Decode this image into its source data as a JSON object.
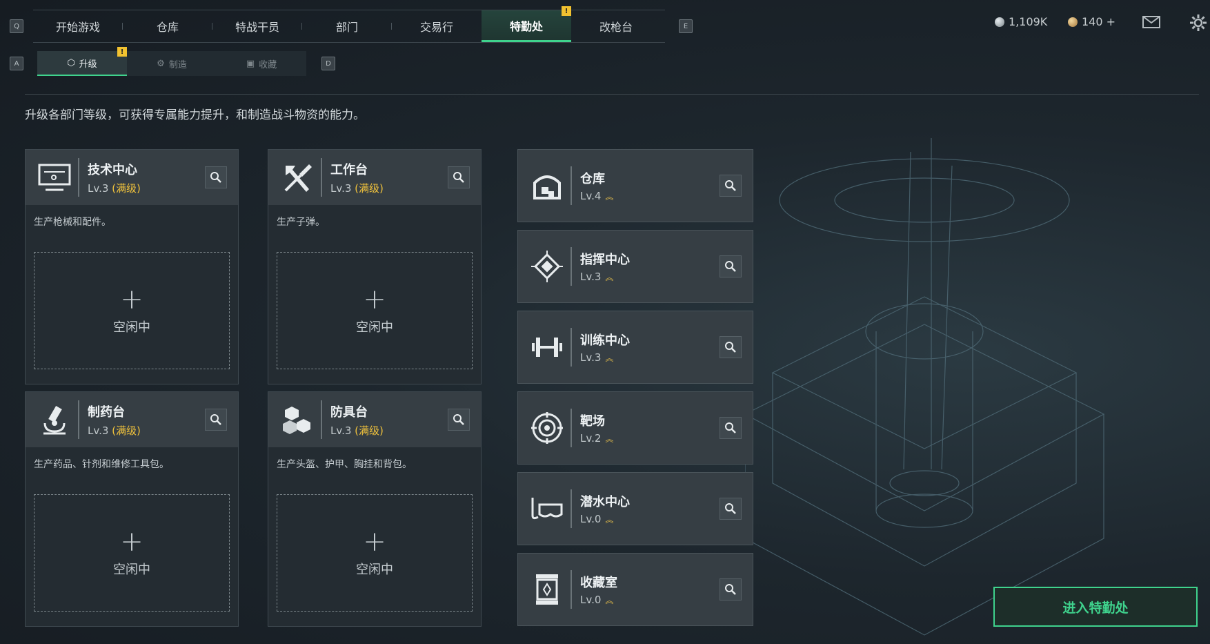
{
  "keys": {
    "q": "Q",
    "e": "E",
    "a": "A",
    "d": "D"
  },
  "tabs": [
    {
      "label": "开始游戏"
    },
    {
      "label": "仓库"
    },
    {
      "label": "特战干员"
    },
    {
      "label": "部门"
    },
    {
      "label": "交易行"
    },
    {
      "label": "特勤处",
      "active": true,
      "alert": "!"
    },
    {
      "label": "改枪台"
    }
  ],
  "subtabs": [
    {
      "label": "升级",
      "active": true,
      "alert": "!",
      "icon": "upgrade-icon"
    },
    {
      "label": "制造",
      "icon": "gear-icon"
    },
    {
      "label": "收藏",
      "icon": "collection-icon"
    }
  ],
  "currency": {
    "silver": "1,109K",
    "gold": "140 +"
  },
  "description": "升级各部门等级，可获得专属能力提升，和制造战斗物资的能力。",
  "workstations": [
    {
      "name": "技术中心",
      "level": "Lv.3",
      "status": "(满级)",
      "desc": "生产枪械和配件。",
      "slot_plus": "+",
      "slot_label": "空闲中",
      "icon": "computer-icon"
    },
    {
      "name": "工作台",
      "level": "Lv.3",
      "status": "(满级)",
      "desc": "生产子弹。",
      "slot_plus": "+",
      "slot_label": "空闲中",
      "icon": "tools-icon"
    },
    {
      "name": "制药台",
      "level": "Lv.3",
      "status": "(满级)",
      "desc": "生产药品、针剂和维修工具包。",
      "slot_plus": "+",
      "slot_label": "空闲中",
      "icon": "microscope-icon"
    },
    {
      "name": "防具台",
      "level": "Lv.3",
      "status": "(满级)",
      "desc": "生产头盔、护甲、胸挂和背包。",
      "slot_plus": "+",
      "slot_label": "空闲中",
      "icon": "armor-cubes-icon"
    }
  ],
  "facilities": [
    {
      "name": "仓库",
      "level": "Lv.4",
      "icon": "warehouse-icon"
    },
    {
      "name": "指挥中心",
      "level": "Lv.3",
      "icon": "chip-icon"
    },
    {
      "name": "训练中心",
      "level": "Lv.3",
      "icon": "dumbbell-icon"
    },
    {
      "name": "靶场",
      "level": "Lv.2",
      "icon": "target-icon"
    },
    {
      "name": "潜水中心",
      "level": "Lv.0",
      "icon": "diving-mask-icon"
    },
    {
      "name": "收藏室",
      "level": "Lv.0",
      "icon": "display-case-icon"
    }
  ],
  "enter_button": "进入特勤处",
  "colors": {
    "accent": "#3fd38d",
    "gold": "#f0c23c",
    "warn": "#f2c230"
  }
}
